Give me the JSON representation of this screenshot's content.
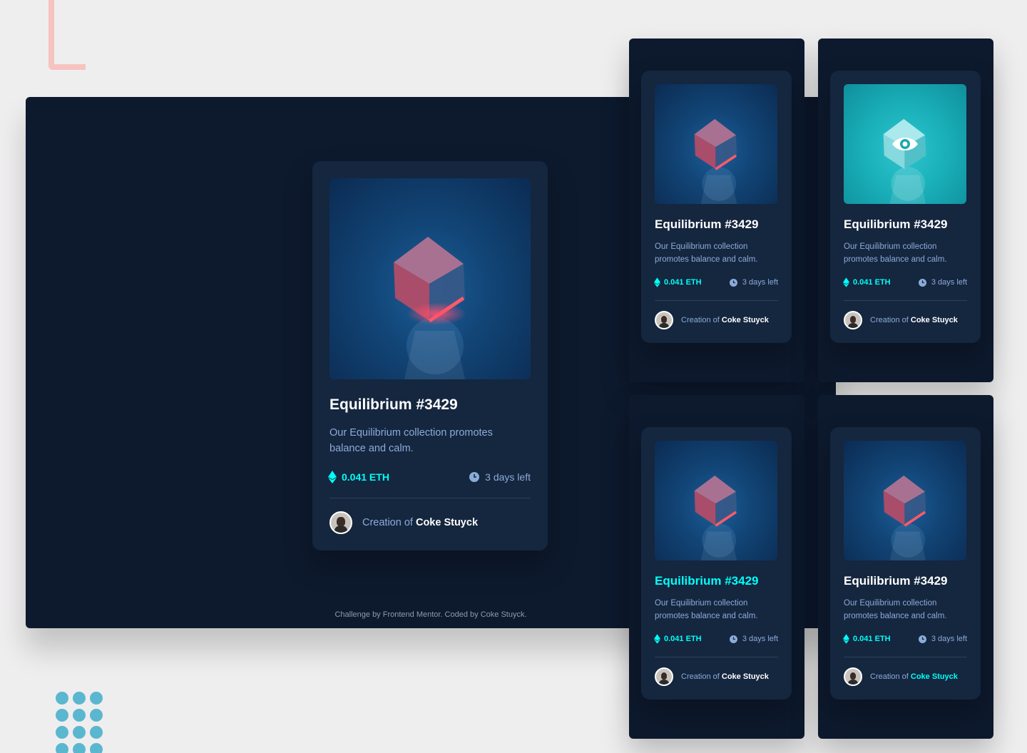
{
  "theme": {
    "page_bg": "#efeeef",
    "panel_bg": "#0d192d",
    "card_bg": "#15263f",
    "accent_cyan": "#00fff8",
    "text_soft": "#8bacd9",
    "white": "#ffffff",
    "deco_pink": "#f6c3c0",
    "deco_dots": "#5bb7cf"
  },
  "footer": {
    "attribution": "Challenge by Frontend Mentor. Coded by Coke Stuyck."
  },
  "card": {
    "title": "Equilibrium #3429",
    "description": "Our Equilibrium collection promotes balance and calm.",
    "price": "0.041 ETH",
    "days_left": "3 days left",
    "creator_prefix": "Creation of",
    "creator_name": "Coke Stuyck",
    "image_alt": "cube-image",
    "icons": [
      "ethereum-icon",
      "clock-icon",
      "view-eye-icon",
      "avatar"
    ]
  },
  "previews": [
    {
      "state": "default"
    },
    {
      "state": "image-hover"
    },
    {
      "state": "title-hover"
    },
    {
      "state": "creator-hover"
    }
  ]
}
